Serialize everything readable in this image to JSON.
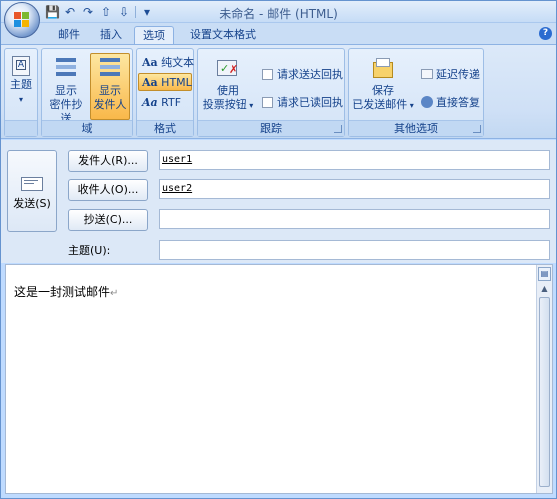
{
  "window": {
    "title": "未命名 - 邮件 (HTML)"
  },
  "qat": {
    "save": "💾",
    "undo": "↶",
    "redo": "↷",
    "up": "⇧",
    "down": "⇩",
    "more": "▾"
  },
  "tabs": [
    {
      "label": "邮件"
    },
    {
      "label": "插入"
    },
    {
      "label": "选项"
    },
    {
      "label": "设置文本格式"
    }
  ],
  "ribbon": {
    "theme": {
      "label": "主题",
      "group": ""
    },
    "domain": {
      "bcc_line1": "显示",
      "bcc_line2": "密件抄送",
      "from_line1": "显示",
      "from_line2": "发件人",
      "group": "域"
    },
    "format": {
      "plain": "纯文本",
      "html": "HTML",
      "rtf": "RTF",
      "group": "格式",
      "aa": "Aa"
    },
    "tracking": {
      "vote_line1": "使用",
      "vote_line2": "投票按钮",
      "read_receipt_delivery": "请求送达回执",
      "read_receipt_read": "请求已读回执",
      "group": "跟踪"
    },
    "more": {
      "save_line1": "保存",
      "save_line2": "已发送邮件",
      "delay": "延迟传递",
      "reply": "直接答复",
      "group": "其他选项"
    }
  },
  "form": {
    "send": "发送(S)",
    "from_btn": "发件人(R)...",
    "to_btn": "收件人(O)...",
    "cc_btn": "抄送(C)...",
    "subject_label": "主题(U):",
    "from_value": "user1",
    "to_value": "user2",
    "cc_value": "",
    "subject_value": ""
  },
  "body": {
    "text": "这是一封测试邮件",
    "para": "↵"
  },
  "colors": {
    "ribbon": "#cfe0f6",
    "accent": "#15428b",
    "pressed": "#f9b84a"
  }
}
